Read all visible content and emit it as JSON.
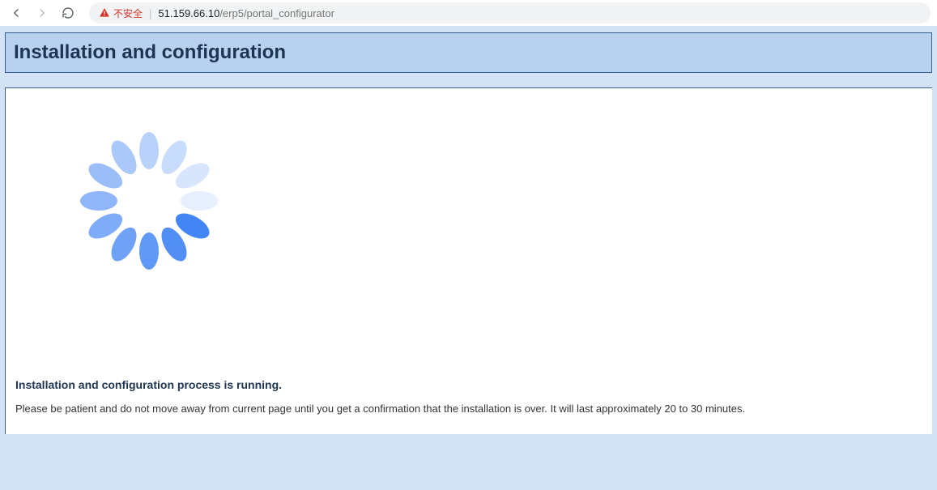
{
  "browser": {
    "insecure_label": "不安全",
    "url_host": "51.159.66.10",
    "url_path": "/erp5/portal_configurator"
  },
  "header": {
    "title": "Installation and configuration"
  },
  "content": {
    "status": "Installation and configuration process is running.",
    "info": "Please be patient and do not move away from current page until you get a confirmation that the installation is over. It will last approximately 20 to 30 minutes."
  }
}
